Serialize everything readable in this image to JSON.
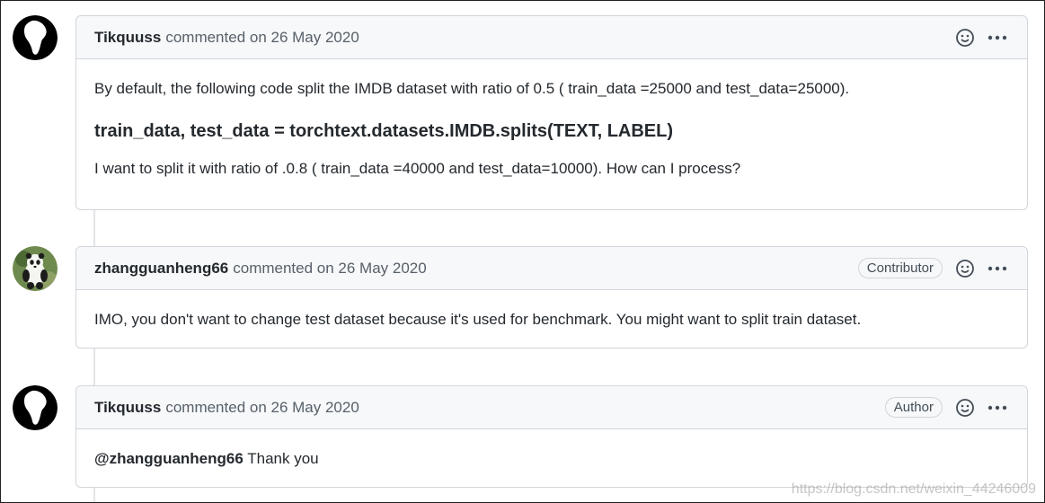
{
  "comments": [
    {
      "author": "Tikquuss",
      "meta": "commented on 26 May 2020",
      "badge": "",
      "paragraph1": "By default, the following code split the IMDB dataset with ratio of 0.5 ( train_data =25000 and test_data=25000).",
      "code": "train_data, test_data = torchtext.datasets.IMDB.splits(TEXT, LABEL)",
      "paragraph2": "I want to split it with ratio of .0.8 ( train_data =40000 and test_data=10000). How can I process?"
    },
    {
      "author": "zhangguanheng66",
      "meta": "commented on 26 May 2020",
      "badge": "Contributor",
      "paragraph1": "IMO, you don't want to change test dataset because it's used for benchmark. You might want to split train dataset."
    },
    {
      "author": "Tikquuss",
      "meta": "commented on 26 May 2020",
      "badge": "Author",
      "mention": "@zhangguanheng66",
      "paragraph1": " Thank you"
    }
  ],
  "icons": {
    "emoji": "smiley-icon",
    "more": "kebab-horizontal-icon"
  },
  "watermark": "https://blog.csdn.net/weixin_44246009"
}
